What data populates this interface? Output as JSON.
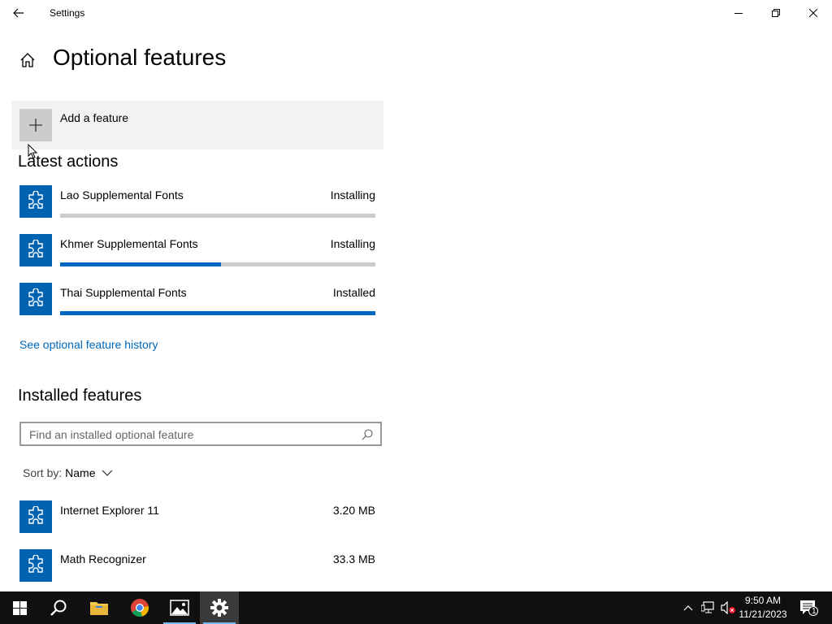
{
  "window": {
    "title": "Settings"
  },
  "page": {
    "title": "Optional features"
  },
  "add_feature": {
    "label": "Add a feature"
  },
  "latest_actions": {
    "heading": "Latest actions",
    "items": [
      {
        "name": "Lao Supplemental Fonts",
        "status": "Installing",
        "progress": 0.0
      },
      {
        "name": "Khmer Supplemental Fonts",
        "status": "Installing",
        "progress": 0.51
      },
      {
        "name": "Thai Supplemental Fonts",
        "status": "Installed",
        "progress": 1.0
      }
    ]
  },
  "history_link": "See optional feature history",
  "installed": {
    "heading": "Installed features",
    "search_placeholder": "Find an installed optional feature",
    "sort_label": "Sort by:",
    "sort_value": "Name",
    "items": [
      {
        "name": "Internet Explorer 11",
        "size": "3.20 MB"
      },
      {
        "name": "Math Recognizer",
        "size": "33.3 MB"
      }
    ]
  },
  "taskbar": {
    "time": "9:50 AM",
    "date": "11/21/2023",
    "notification_count": "1",
    "apps": [
      "start-icon",
      "search-icon",
      "file-explorer-icon",
      "chrome-icon",
      "photos-icon",
      "settings-icon"
    ]
  },
  "colors": {
    "accent": "#0063b1",
    "progress": "#0067c0",
    "link": "#0067b8",
    "taskbar": "#101010"
  }
}
